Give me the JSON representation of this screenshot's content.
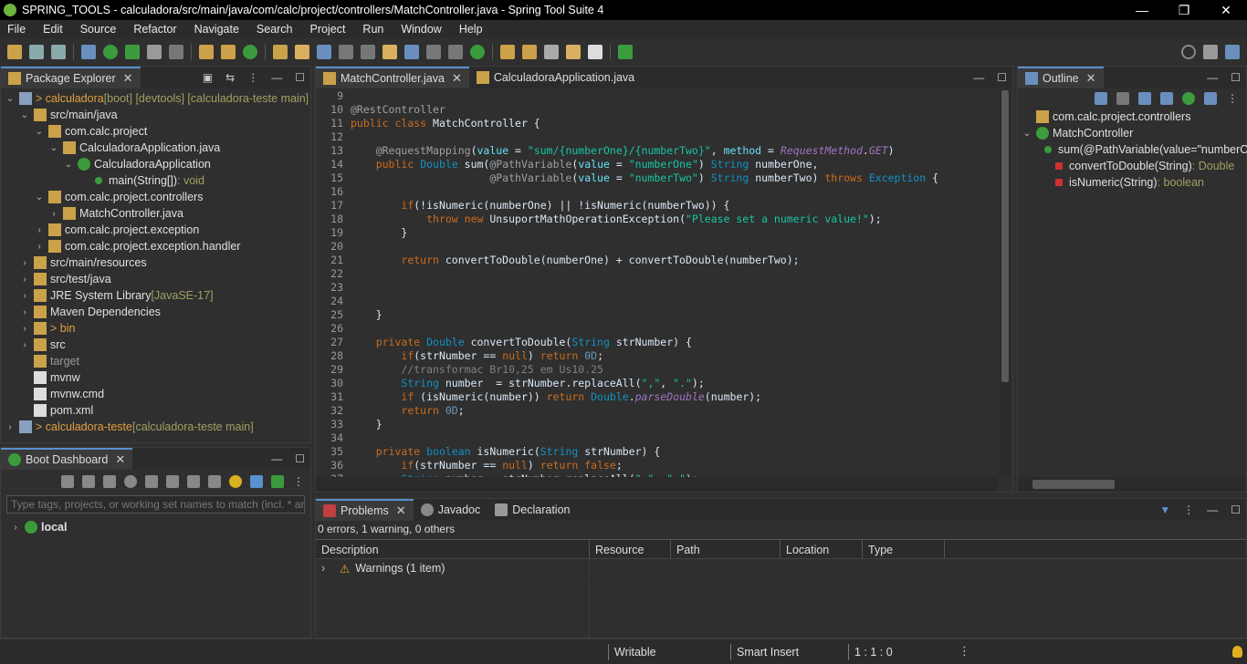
{
  "window": {
    "title": "SPRING_TOOLS - calculadora/src/main/java/com/calc/project/controllers/MatchController.java - Spring Tool Suite 4",
    "minimize": "—",
    "maximize": "❐",
    "close": "✕"
  },
  "menu": [
    "File",
    "Edit",
    "Source",
    "Refactor",
    "Navigate",
    "Search",
    "Project",
    "Run",
    "Window",
    "Help"
  ],
  "package_explorer": {
    "tab_label": "Package Explorer",
    "tree": [
      {
        "indent": 0,
        "twisty": "⌄",
        "icon": "project-icon",
        "label": "> calculadora",
        "suffix": " [boot] [devtools] [calculadora-teste main]",
        "color": "orange"
      },
      {
        "indent": 1,
        "twisty": "⌄",
        "icon": "source-folder-icon",
        "label": "src/main/java",
        "suffix": ""
      },
      {
        "indent": 2,
        "twisty": "⌄",
        "icon": "package-icon",
        "label": "com.calc.project",
        "suffix": ""
      },
      {
        "indent": 3,
        "twisty": "⌄",
        "icon": "java-file-icon",
        "label": "CalculadoraApplication.java",
        "suffix": ""
      },
      {
        "indent": 4,
        "twisty": "⌄",
        "icon": "class-icon",
        "label": "CalculadoraApplication",
        "suffix": ""
      },
      {
        "indent": 5,
        "twisty": "",
        "icon": "method-icon",
        "label": "main(String[])",
        "suffix": " : void"
      },
      {
        "indent": 2,
        "twisty": "⌄",
        "icon": "package-icon",
        "label": "com.calc.project.controllers",
        "suffix": ""
      },
      {
        "indent": 3,
        "twisty": "›",
        "icon": "java-file-icon",
        "label": "MatchController.java",
        "suffix": ""
      },
      {
        "indent": 2,
        "twisty": "›",
        "icon": "package-icon",
        "label": "com.calc.project.exception",
        "suffix": ""
      },
      {
        "indent": 2,
        "twisty": "›",
        "icon": "package-icon",
        "label": "com.calc.project.exception.handler",
        "suffix": ""
      },
      {
        "indent": 1,
        "twisty": "›",
        "icon": "source-folder-icon",
        "label": "src/main/resources",
        "suffix": ""
      },
      {
        "indent": 1,
        "twisty": "›",
        "icon": "source-folder-icon",
        "label": "src/test/java",
        "suffix": ""
      },
      {
        "indent": 1,
        "twisty": "›",
        "icon": "library-icon",
        "label": "JRE System Library",
        "suffix": " [JavaSE-17]"
      },
      {
        "indent": 1,
        "twisty": "›",
        "icon": "library-icon",
        "label": "Maven Dependencies",
        "suffix": ""
      },
      {
        "indent": 1,
        "twisty": "›",
        "icon": "folder-icon",
        "label": "> bin",
        "suffix": "",
        "color": "orange"
      },
      {
        "indent": 1,
        "twisty": "›",
        "icon": "folder-icon",
        "label": "src",
        "suffix": ""
      },
      {
        "indent": 1,
        "twisty": "",
        "icon": "folder-icon",
        "label": "target",
        "suffix": "",
        "color": "grey"
      },
      {
        "indent": 1,
        "twisty": "",
        "icon": "file-icon",
        "label": "mvnw",
        "suffix": ""
      },
      {
        "indent": 1,
        "twisty": "",
        "icon": "cmd-file-icon",
        "label": "mvnw.cmd",
        "suffix": ""
      },
      {
        "indent": 1,
        "twisty": "",
        "icon": "xml-file-icon",
        "label": "pom.xml",
        "suffix": ""
      },
      {
        "indent": 0,
        "twisty": "›",
        "icon": "project-icon",
        "label": "> calculadora-teste",
        "suffix": " [calculadora-teste main]",
        "color": "orange"
      }
    ]
  },
  "boot_dashboard": {
    "tab_label": "Boot Dashboard",
    "search_placeholder": "Type tags, projects, or working set names to match (incl. * and",
    "items": [
      {
        "label": "local"
      }
    ]
  },
  "editor": {
    "tabs": [
      {
        "label": "MatchController.java",
        "active": true
      },
      {
        "label": "CalculadoraApplication.java",
        "active": false
      }
    ],
    "line_numbers": [
      "9",
      "10",
      "11",
      "12",
      "13",
      "14",
      "15",
      "16",
      "17",
      "18",
      "19",
      "20",
      "21",
      "22",
      "23",
      "24",
      "25",
      "26",
      "27",
      "28",
      "29",
      "30",
      "31",
      "32",
      "33",
      "34",
      "35",
      "36",
      "37"
    ],
    "code": [
      "",
      "@RestController",
      "public class MatchController {",
      "",
      "    @RequestMapping(value = \"sum/{numberOne}/{numberTwo}\", method = RequestMethod.GET)",
      "    public Double sum(@PathVariable(value = \"numberOne\") String numberOne,",
      "                      @PathVariable(value = \"numberTwo\") String numberTwo) throws Exception {",
      "",
      "        if(!isNumeric(numberOne) || !isNumeric(numberTwo)) {",
      "            throw new UnsuportMathOperationException(\"Please set a numeric value!\");",
      "        }",
      "",
      "        return convertToDouble(numberOne) + convertToDouble(numberTwo);",
      "",
      "",
      "",
      "    }",
      "",
      "    private Double convertToDouble(String strNumber) {",
      "        if(strNumber == null) return 0D;",
      "        //transformac Br10,25 em Us10.25",
      "        String number  = strNumber.replaceAll(\",\", \".\");",
      "        if (isNumeric(number)) return Double.parseDouble(number);",
      "        return 0D;",
      "    }",
      "",
      "    private boolean isNumeric(String strNumber) {",
      "        if(strNumber == null) return false;",
      "        String number = strNumber.replaceAll(\",\", \".\");"
    ]
  },
  "outline": {
    "tab_label": "Outline",
    "items": [
      {
        "indent": 0,
        "twisty": "",
        "icon": "package-icon",
        "label": "com.calc.project.controllers",
        "suffix": ""
      },
      {
        "indent": 0,
        "twisty": "⌄",
        "icon": "class-icon",
        "label": "MatchController",
        "suffix": ""
      },
      {
        "indent": 1,
        "twisty": "",
        "icon": "public-method-icon",
        "label": "sum(@PathVariable(value=\"numberOne\")",
        "suffix": ""
      },
      {
        "indent": 1,
        "twisty": "",
        "icon": "private-method-icon",
        "label": "convertToDouble(String)",
        "suffix": " : Double"
      },
      {
        "indent": 1,
        "twisty": "",
        "icon": "private-method-icon",
        "label": "isNumeric(String)",
        "suffix": " : boolean"
      }
    ]
  },
  "problems": {
    "tabs": [
      {
        "label": "Problems",
        "active": true
      },
      {
        "label": "Javadoc",
        "active": false
      },
      {
        "label": "Declaration",
        "active": false
      }
    ],
    "summary": "0 errors, 1 warning, 0 others",
    "columns": [
      "Description",
      "Resource",
      "Path",
      "Location",
      "Type"
    ],
    "rows": [
      {
        "label": "Warnings (1 item)"
      }
    ]
  },
  "status": {
    "writable": "Writable",
    "insert_mode": "Smart Insert",
    "position": "1 : 1 : 0"
  },
  "colors": {
    "accent": "#5a8fd0",
    "keyword": "#cc6c1d",
    "string": "#17c6a3",
    "type": "#1290c3"
  }
}
